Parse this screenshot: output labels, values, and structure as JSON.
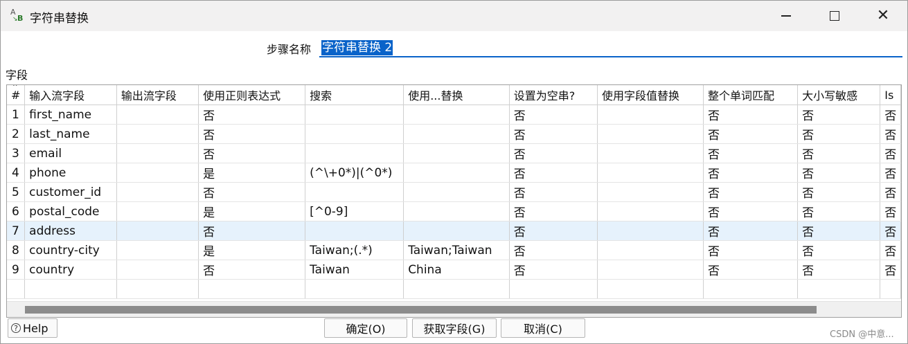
{
  "window": {
    "title": "字符串替换",
    "app_icon": "string-replace-icon"
  },
  "step": {
    "label": "步骤名称",
    "value": "字符串替换 2"
  },
  "fields": {
    "label": "字段",
    "columns": [
      "#",
      "输入流字段",
      "输出流字段",
      "使用正则表达式",
      "搜索",
      "使用...替换",
      "设置为空串?",
      "使用字段值替换",
      "整个单词匹配",
      "大小写敏感",
      "Is"
    ],
    "rows": [
      [
        "1",
        "first_name",
        "",
        "否",
        "",
        "",
        "否",
        "",
        "否",
        "否",
        "否"
      ],
      [
        "2",
        "last_name",
        "",
        "否",
        "",
        "",
        "否",
        "",
        "否",
        "否",
        "否"
      ],
      [
        "3",
        "email",
        "",
        "否",
        "",
        "",
        "否",
        "",
        "否",
        "否",
        "否"
      ],
      [
        "4",
        "phone",
        "",
        "是",
        "(^\\+0*)|(^0*)",
        "",
        "否",
        "",
        "否",
        "否",
        "否"
      ],
      [
        "5",
        "customer_id",
        "",
        "否",
        "",
        "",
        "否",
        "",
        "否",
        "否",
        "否"
      ],
      [
        "6",
        "postal_code",
        "",
        "是",
        "[^0-9]",
        "",
        "否",
        "",
        "否",
        "否",
        "否"
      ],
      [
        "7",
        "address",
        "",
        "否",
        "",
        "",
        "否",
        "",
        "否",
        "否",
        "否"
      ],
      [
        "8",
        "country-city",
        "",
        "是",
        "Taiwan;(.*)",
        "Taiwan;Taiwan",
        "否",
        "",
        "否",
        "否",
        "否"
      ],
      [
        "9",
        "country",
        "",
        "否",
        "Taiwan",
        "China",
        "否",
        "",
        "否",
        "否",
        "否"
      ]
    ],
    "selected_row": 7
  },
  "buttons": {
    "help": "Help",
    "ok": "确定(O)",
    "get_fields": "获取字段(G)",
    "cancel": "取消(C)"
  },
  "watermark": "CSDN @中意...",
  "colors": {
    "accent": "#0a63c9",
    "selected_row": "#e6f2fc"
  }
}
